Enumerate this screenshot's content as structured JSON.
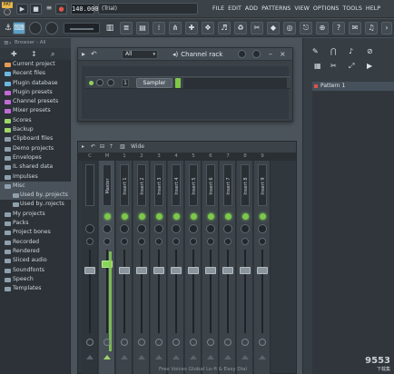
{
  "colors": {
    "bg": "#4a5259",
    "accent_green": "#7fc847",
    "pattern_marker": "#d9534a",
    "badge_yellow": "#e8b64a"
  },
  "top": {
    "pattern_badge": "PAT",
    "tempo": "140.000",
    "song_title": "(Trial)",
    "menu": [
      "FILE",
      "EDIT",
      "ADD",
      "PATTERNS",
      "VIEW",
      "OPTIONS",
      "TOOLS",
      "HELP"
    ]
  },
  "browser": {
    "header": "Browser - All",
    "items": [
      {
        "label": "Current project",
        "icon": "folder-open-icon",
        "color": "#e39a53",
        "level": 0,
        "selected": false
      },
      {
        "label": "Recent files",
        "icon": "folder-icon",
        "color": "#6bb7e0",
        "level": 0,
        "selected": false
      },
      {
        "label": "Plugin database",
        "icon": "folder-icon",
        "color": "#6bb7e0",
        "level": 0,
        "selected": false
      },
      {
        "label": "Plugin presets",
        "icon": "folder-icon",
        "color": "#c16bd6",
        "level": 0,
        "selected": false
      },
      {
        "label": "Channel presets",
        "icon": "folder-icon",
        "color": "#c16bd6",
        "level": 0,
        "selected": false
      },
      {
        "label": "Mixer presets",
        "icon": "folder-icon",
        "color": "#c16bd6",
        "level": 0,
        "selected": false
      },
      {
        "label": "Scores",
        "icon": "note-icon",
        "color": "#9fd66b",
        "level": 0,
        "selected": false
      },
      {
        "label": "Backup",
        "icon": "folder-icon",
        "color": "#9fd66b",
        "level": 0,
        "selected": false
      },
      {
        "label": "Clipboard files",
        "icon": "folder-icon",
        "color": "#8fa0ad",
        "level": 0,
        "selected": false
      },
      {
        "label": "Demo projects",
        "icon": "folder-icon",
        "color": "#8fa0ad",
        "level": 0,
        "selected": false
      },
      {
        "label": "Envelopes",
        "icon": "folder-icon",
        "color": "#8fa0ad",
        "level": 0,
        "selected": false
      },
      {
        "label": "IL shared data",
        "icon": "folder-icon",
        "color": "#8fa0ad",
        "level": 0,
        "selected": false
      },
      {
        "label": "Impulses",
        "icon": "folder-icon",
        "color": "#8fa0ad",
        "level": 0,
        "selected": false
      },
      {
        "label": "Misc",
        "icon": "folder-open-icon",
        "color": "#8fa0ad",
        "level": 0,
        "selected": true
      },
      {
        "label": "Used by..projects",
        "icon": "folder-icon",
        "color": "#8fa0ad",
        "level": 1,
        "selected": true
      },
      {
        "label": "Used by..rojects",
        "icon": "folder-icon",
        "color": "#8fa0ad",
        "level": 1,
        "selected": false
      },
      {
        "label": "My projects",
        "icon": "folder-icon",
        "color": "#8fa0ad",
        "level": 0,
        "selected": false
      },
      {
        "label": "Packs",
        "icon": "folder-icon",
        "color": "#8fa0ad",
        "level": 0,
        "selected": false
      },
      {
        "label": "Project bones",
        "icon": "folder-icon",
        "color": "#8fa0ad",
        "level": 0,
        "selected": false
      },
      {
        "label": "Recorded",
        "icon": "folder-icon",
        "color": "#8fa0ad",
        "level": 0,
        "selected": false
      },
      {
        "label": "Rendered",
        "icon": "folder-icon",
        "color": "#8fa0ad",
        "level": 0,
        "selected": false
      },
      {
        "label": "Sliced audio",
        "icon": "folder-icon",
        "color": "#8fa0ad",
        "level": 0,
        "selected": false
      },
      {
        "label": "Soundfonts",
        "icon": "folder-icon",
        "color": "#8fa0ad",
        "level": 0,
        "selected": false
      },
      {
        "label": "Speech",
        "icon": "folder-icon",
        "color": "#8fa0ad",
        "level": 0,
        "selected": false
      },
      {
        "label": "Templates",
        "icon": "folder-icon",
        "color": "#8fa0ad",
        "level": 0,
        "selected": false
      }
    ]
  },
  "channel_rack": {
    "filter": "All",
    "title": "Channel rack",
    "channel_number": "1",
    "channel_name": "Sampler"
  },
  "mixer": {
    "title": "Wide",
    "headers": [
      "C",
      "M",
      "1",
      "2",
      "3",
      "4",
      "5",
      "6",
      "7",
      "8",
      "9"
    ],
    "strips": [
      "",
      "Master",
      "Insert 1",
      "Insert 2",
      "Insert 3",
      "Insert 4",
      "Insert 5",
      "Insert 6",
      "Insert 7",
      "Insert 8",
      "Insert 9"
    ]
  },
  "playlist": {
    "patterns": [
      "Pattern 1"
    ]
  },
  "watermark": {
    "main": "9553",
    "sub": "下载集",
    "bottom": "Free Voices Global Lo-fi & Easy Dial"
  }
}
